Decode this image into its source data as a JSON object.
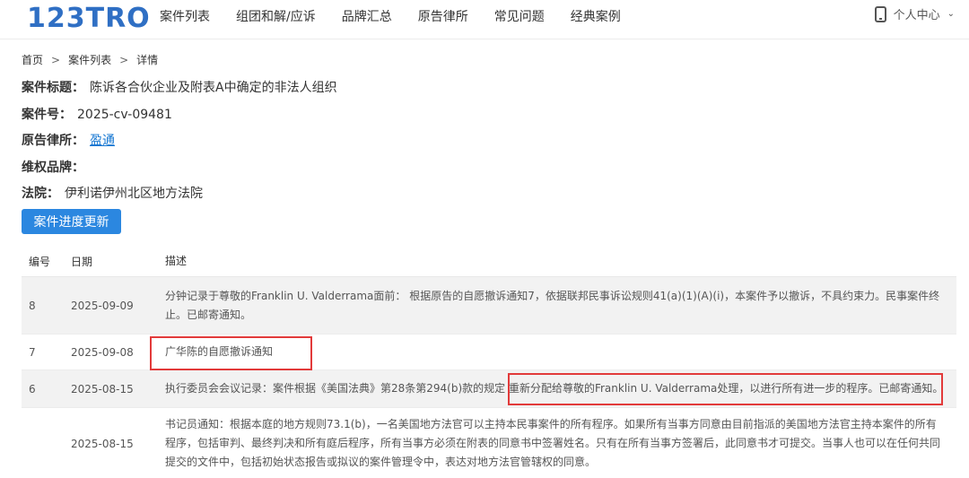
{
  "header": {
    "logo": "123TRO",
    "nav": [
      "案件列表",
      "组团和解/应诉",
      "品牌汇总",
      "原告律所",
      "常见问题",
      "经典案例"
    ],
    "user_center": "个人中心"
  },
  "breadcrumb": [
    "首页",
    "案件列表",
    "详情"
  ],
  "case": {
    "title_label": "案件标题：",
    "title": "陈诉各合伙企业及附表A中确定的非法人组织",
    "number_label": "案件号：",
    "number": "2025-cv-09481",
    "firm_label": "原告律所：",
    "firm": "盈通",
    "brand_label": "维权品牌：",
    "brand": "",
    "court_label": "法院：",
    "court": "伊利诺伊州北区地方法院"
  },
  "update_button": "案件进度更新",
  "table": {
    "headers": [
      "编号",
      "日期",
      "描述"
    ],
    "rows": [
      {
        "num": "8",
        "date": "2025-09-09",
        "desc": "分钟记录于尊敬的Franklin U. Valderrama面前： 根据原告的自愿撤诉通知7，依据联邦民事诉讼规则41(a)(1)(A)(i)，本案件予以撤诉，不具约束力。民事案件终止。已邮寄通知。"
      },
      {
        "num": "7",
        "date": "2025-09-08",
        "desc": "广华陈的自愿撤诉通知"
      },
      {
        "num": "6",
        "date": "2025-08-15",
        "desc": "执行委员会会议记录：案件根据《美国法典》第28条第294(b)款的规定 重新分配给尊敬的Franklin U. Valderrama处理，以进行所有进一步的程序。已邮寄通知。"
      },
      {
        "num": "",
        "date": "2025-08-15",
        "desc": "书记员通知：根据本庭的地方规则73.1(b)，一名美国地方法官可以主持本民事案件的所有程序。如果所有当事方同意由目前指派的美国地方法官主持本案件的所有程序，包括审判、最终判决和所有庭后程序，所有当事方必须在附表的同意书中签署姓名。只有在所有当事方签署后，此同意书才可提交。当事人也可以在任何共同提交的文件中，包括初始状态报告或拟议的案件管理令中，表达对地方法官管辖权的同意。"
      }
    ]
  },
  "colors": {
    "brand": "#2f6fc4",
    "button": "#2b87e0",
    "link": "#1677d2",
    "highlight": "#e23a3a"
  }
}
